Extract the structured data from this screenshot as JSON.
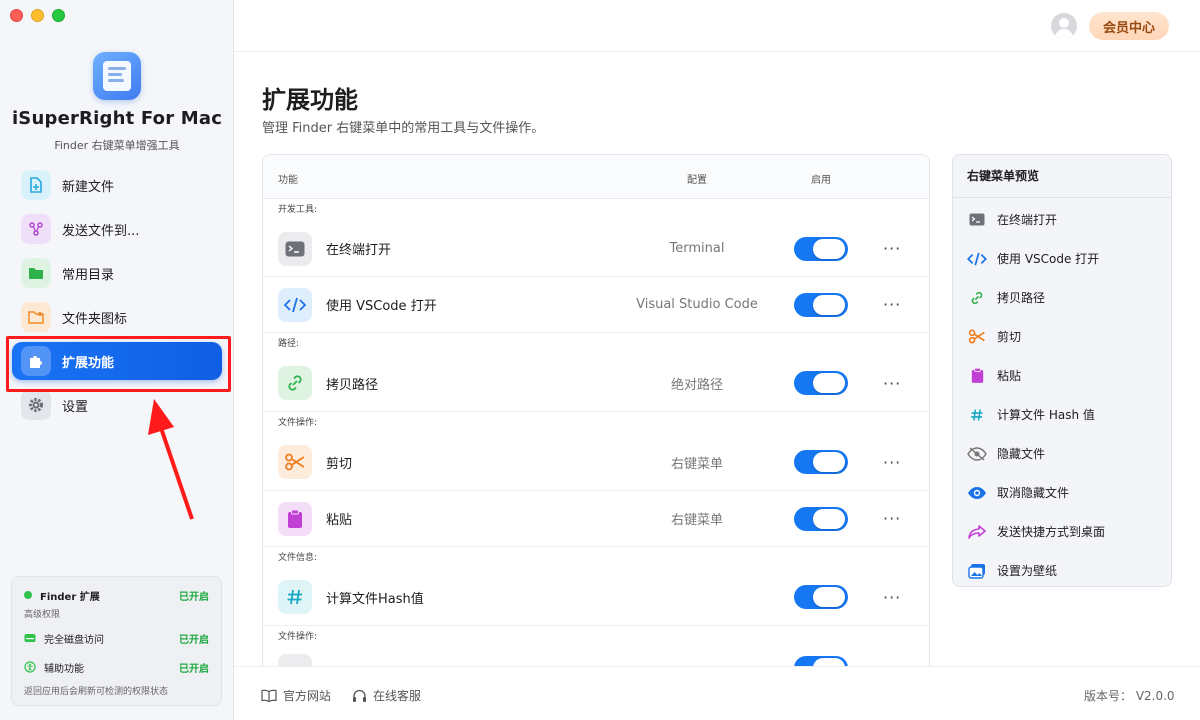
{
  "app": {
    "title": "iSuperRight For Mac",
    "subtitle": "Finder 右键菜单增强工具"
  },
  "sidebar": {
    "items": [
      {
        "label": "新建文件",
        "icon": "new-file-icon",
        "color": "#2aa8e0",
        "bg": "#d9f1fb"
      },
      {
        "label": "发送文件到...",
        "icon": "share-icon",
        "color": "#b04ad0",
        "bg": "#f0dff8"
      },
      {
        "label": "常用目录",
        "icon": "folder-icon",
        "color": "#2fb14c",
        "bg": "#dff3e2"
      },
      {
        "label": "文件夹图标",
        "icon": "folder-image-icon",
        "color": "#f08a2b",
        "bg": "#fde8d4"
      },
      {
        "label": "扩展功能",
        "icon": "puzzle-icon",
        "active": true
      },
      {
        "label": "设置",
        "icon": "gear-icon",
        "color": "#6b7079",
        "bg": "#e3e5ea"
      }
    ]
  },
  "permissions": {
    "finder_ext": {
      "label": "Finder 扩展",
      "status": "已开启"
    },
    "advanced_label": "高级权限",
    "disk_access": {
      "label": "完全磁盘访问",
      "status": "已开启"
    },
    "accessibility": {
      "label": "辅助功能",
      "status": "已开启"
    },
    "note": "返回应用后会刷新可检测的权限状态"
  },
  "header": {
    "member_label": "会员中心"
  },
  "page": {
    "title": "扩展功能",
    "description": "管理 Finder 右键菜单中的常用工具与文件操作。"
  },
  "table": {
    "columns": {
      "feature": "功能",
      "config": "配置",
      "enabled": "启用"
    },
    "groups": [
      {
        "label": "开发工具:",
        "rows": [
          {
            "name": "在终端打开",
            "config": "Terminal",
            "icon": "terminal-icon",
            "enabled": true
          },
          {
            "name": "使用 VSCode 打开",
            "config": "Visual Studio Code",
            "icon": "code-icon",
            "enabled": true
          }
        ]
      },
      {
        "label": "路径:",
        "rows": [
          {
            "name": "拷贝路径",
            "config": "绝对路径",
            "icon": "link-icon",
            "enabled": true
          }
        ]
      },
      {
        "label": "文件操作:",
        "rows": [
          {
            "name": "剪切",
            "config": "右键菜单",
            "icon": "scissors-icon",
            "enabled": true
          },
          {
            "name": "粘贴",
            "config": "右键菜单",
            "icon": "clipboard-icon",
            "enabled": true
          }
        ]
      },
      {
        "label": "文件信息:",
        "rows": [
          {
            "name": "计算文件Hash值",
            "config": "",
            "icon": "hash-icon",
            "enabled": true
          }
        ]
      },
      {
        "label": "文件操作:",
        "rows": []
      }
    ],
    "more_label": "···"
  },
  "preview": {
    "title": "右键菜单预览",
    "items": [
      {
        "label": "在终端打开",
        "icon": "terminal-icon"
      },
      {
        "label": "使用 VSCode 打开",
        "icon": "code-icon"
      },
      {
        "label": "拷贝路径",
        "icon": "link-icon"
      },
      {
        "label": "剪切",
        "icon": "scissors-icon"
      },
      {
        "label": "粘贴",
        "icon": "clipboard-icon"
      },
      {
        "label": "计算文件 Hash 值",
        "icon": "hash-icon"
      },
      {
        "label": "隐藏文件",
        "icon": "eye-off-icon"
      },
      {
        "label": "取消隐藏文件",
        "icon": "eye-icon"
      },
      {
        "label": "发送快捷方式到桌面",
        "icon": "share-arrow-icon"
      },
      {
        "label": "设置为壁纸",
        "icon": "wallpaper-icon"
      }
    ]
  },
  "footer": {
    "website": "官方网站",
    "support": "在线客服",
    "version": "版本号： V2.0.0"
  }
}
